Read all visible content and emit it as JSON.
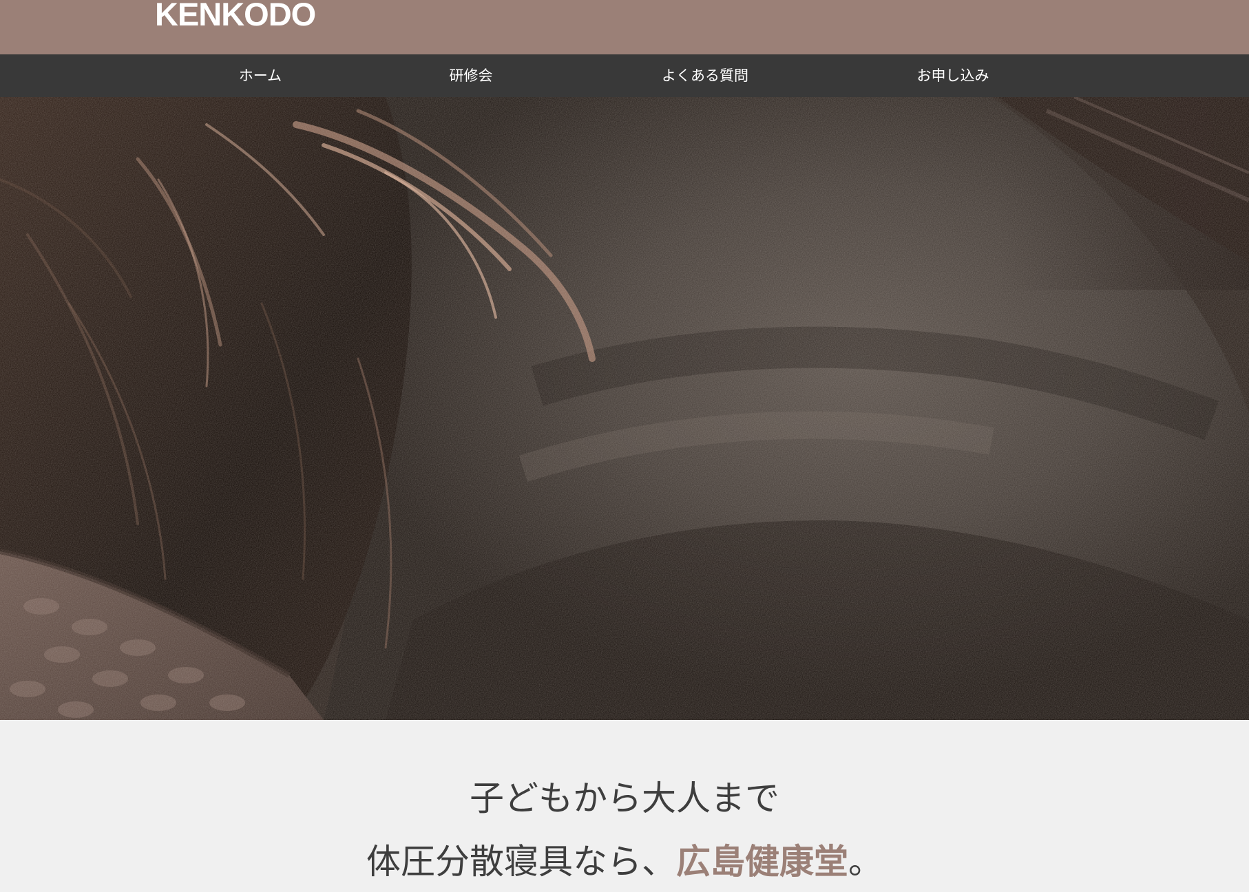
{
  "header": {
    "logo": "KENKODO",
    "background_color": "#9b8077"
  },
  "nav": {
    "background_color": "#393939",
    "items": [
      {
        "label": "ホーム"
      },
      {
        "label": "研修会"
      },
      {
        "label": "よくある質問"
      },
      {
        "label": "お申し込み"
      }
    ]
  },
  "hero": {
    "image": "hair-on-grey-pillow-photo"
  },
  "main": {
    "tagline_line1": "子どもから大人まで",
    "tagline_line2_prefix": "体圧分散寝具なら、",
    "tagline_brand": "広島健康堂",
    "tagline_suffix": "。",
    "brand_color": "#9b8077"
  }
}
